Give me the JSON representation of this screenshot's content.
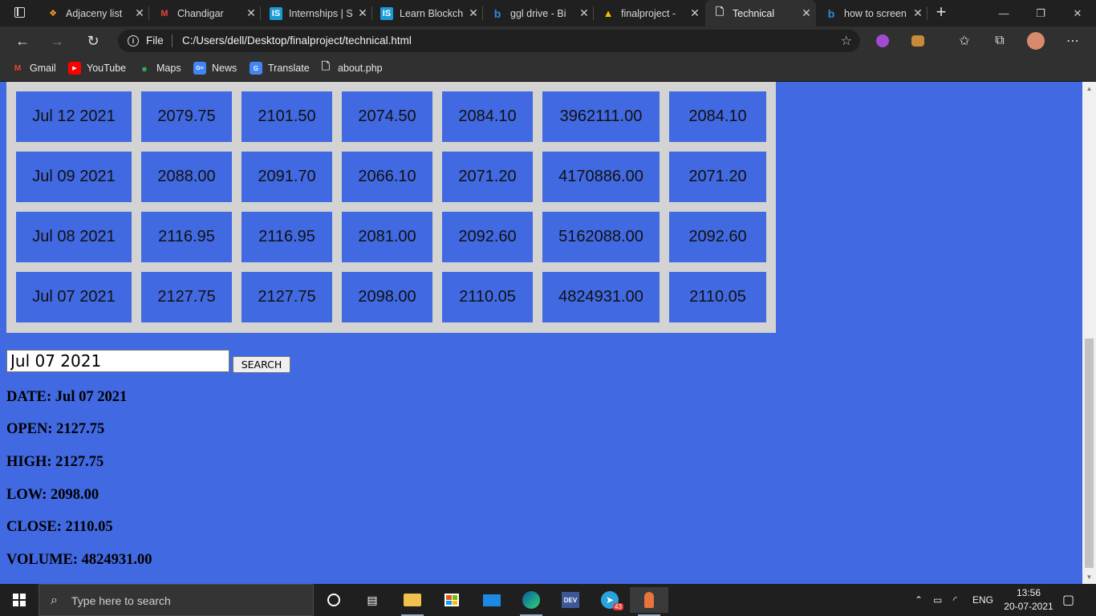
{
  "browser": {
    "tabs": [
      {
        "title": "Adjaceny list",
        "favicon": "code-icon",
        "color": "#f5a623"
      },
      {
        "title": "Chandigar",
        "favicon": "gmail-icon",
        "color": "#ea4335"
      },
      {
        "title": "Internships | S",
        "favicon": "is-icon",
        "color": "#1a9bd7"
      },
      {
        "title": "Learn Blockch",
        "favicon": "is-icon",
        "color": "#1a9bd7"
      },
      {
        "title": "ggl drive - Bi",
        "favicon": "bing-icon",
        "color": "#2a8be8"
      },
      {
        "title": "finalproject -",
        "favicon": "drive-icon",
        "color": "#fbbc04"
      },
      {
        "title": "Technical",
        "favicon": "page-icon",
        "color": "#dddddd"
      },
      {
        "title": "how to screen",
        "favicon": "bing-icon",
        "color": "#2a8be8"
      }
    ],
    "active_tab_index": 6,
    "address": {
      "scheme_label": "File",
      "url": "C:/Users/dell/Desktop/finalproject/technical.html"
    },
    "bookmarks": [
      {
        "label": "Gmail",
        "icon": "gmail-icon",
        "color": "#ea4335"
      },
      {
        "label": "YouTube",
        "icon": "youtube-icon",
        "color": "#ff0000"
      },
      {
        "label": "Maps",
        "icon": "maps-icon",
        "color": "#34a853"
      },
      {
        "label": "News",
        "icon": "news-icon",
        "color": "#4285f4"
      },
      {
        "label": "Translate",
        "icon": "translate-icon",
        "color": "#4285f4"
      },
      {
        "label": "about.php",
        "icon": "page-icon",
        "color": "#dddddd"
      }
    ]
  },
  "page": {
    "background": "#4169e1",
    "table_rows": [
      [
        "Jul 12 2021",
        "2079.75",
        "2101.50",
        "2074.50",
        "2084.10",
        "3962111.00",
        "2084.10"
      ],
      [
        "Jul 09 2021",
        "2088.00",
        "2091.70",
        "2066.10",
        "2071.20",
        "4170886.00",
        "2071.20"
      ],
      [
        "Jul 08 2021",
        "2116.95",
        "2116.95",
        "2081.00",
        "2092.60",
        "5162088.00",
        "2092.60"
      ],
      [
        "Jul 07 2021",
        "2127.75",
        "2127.75",
        "2098.00",
        "2110.05",
        "4824931.00",
        "2110.05"
      ]
    ],
    "search": {
      "value": "Jul 07 2021",
      "button_label": "SEARCH"
    },
    "result": {
      "date": "DATE: Jul 07 2021",
      "open": "OPEN: 2127.75",
      "high": "HIGH: 2127.75",
      "low": "LOW: 2098.00",
      "close": "CLOSE: 2110.05",
      "volume": "VOLUME: 4824931.00"
    }
  },
  "taskbar": {
    "search_placeholder": "Type here to search",
    "apps": [
      {
        "name": "task-view-icon"
      },
      {
        "name": "widgets-icon"
      },
      {
        "name": "file-explorer-icon"
      },
      {
        "name": "store-icon"
      },
      {
        "name": "mail-icon"
      },
      {
        "name": "edge-icon"
      },
      {
        "name": "dev-icon"
      },
      {
        "name": "telegram-icon",
        "badge": "43"
      },
      {
        "name": "paint-icon"
      }
    ],
    "tray": {
      "language": "ENG",
      "time": "13:56",
      "date": "20-07-2021"
    }
  }
}
